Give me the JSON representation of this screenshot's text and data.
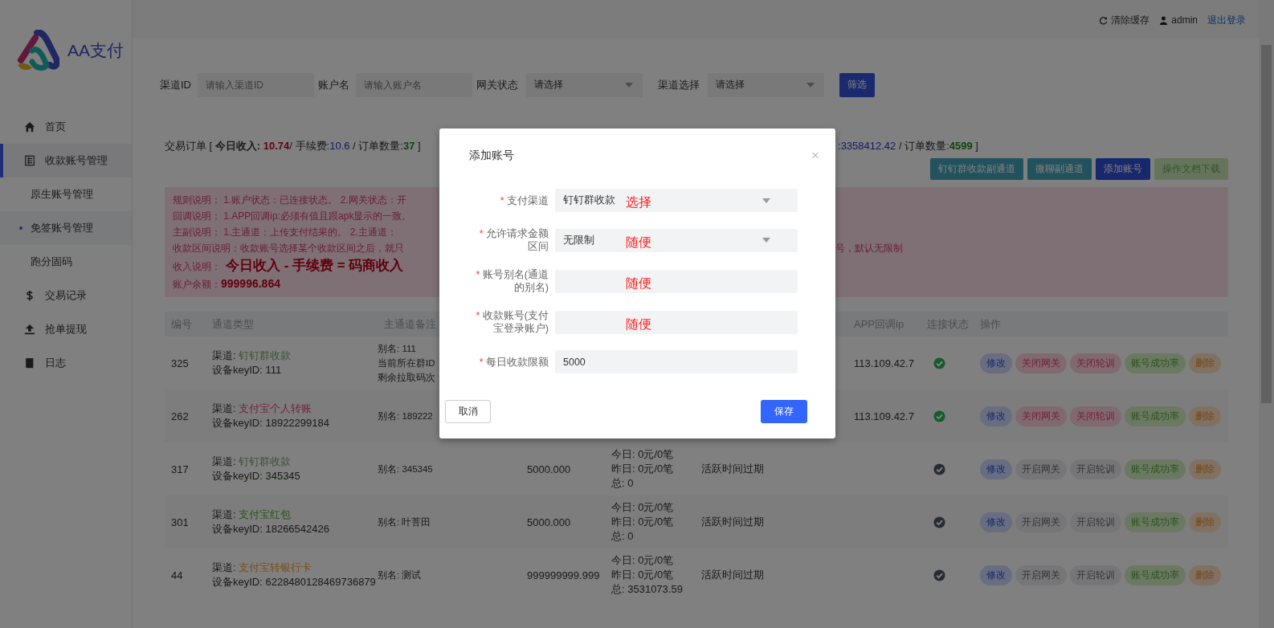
{
  "header": {
    "clear_cache": "清除缓存",
    "user": "admin",
    "logout": "退出登录"
  },
  "logo": {
    "text": "AA支付"
  },
  "sidebar": {
    "items": [
      {
        "label": "首页",
        "kind": "home",
        "selected": false
      },
      {
        "label": "收款账号管理",
        "kind": "list",
        "selected": true,
        "children": [
          {
            "label": "原生账号管理",
            "selected": false
          },
          {
            "label": "免签账号管理",
            "selected": true
          },
          {
            "label": "跑分固码",
            "selected": false
          }
        ]
      },
      {
        "label": "交易记录",
        "kind": "dollar",
        "selected": false
      },
      {
        "label": "抢单提现",
        "kind": "upload",
        "selected": false
      },
      {
        "label": "日志",
        "kind": "book",
        "selected": false
      }
    ]
  },
  "filters": [
    {
      "label": "渠道ID",
      "kind": "input",
      "placeholder": "请输入渠道ID"
    },
    {
      "label": "账户名",
      "kind": "input",
      "placeholder": "请输入账户名"
    },
    {
      "label": "网关状态",
      "kind": "select",
      "placeholder": "请选择"
    },
    {
      "label": "渠道选择",
      "kind": "select",
      "placeholder": "请选择"
    }
  ],
  "filter_button": "筛选",
  "stats": {
    "left": [
      {
        "text": "交易订单 [ ",
        "kind": "plain"
      },
      {
        "text": "今日收入: ",
        "kind": "bold"
      },
      {
        "text": "10.74",
        "kind": "red"
      },
      {
        "text": "/ 手续费:",
        "kind": "plain"
      },
      {
        "text": "10.6",
        "kind": "blue"
      },
      {
        "text": " / 订单数量:",
        "kind": "plain"
      },
      {
        "text": "37",
        "kind": "green"
      },
      {
        "text": " ]",
        "kind": "plain"
      }
    ],
    "right": [
      {
        "text": ":",
        "kind": "plain"
      },
      {
        "text": "3358412.42",
        "kind": "blue"
      },
      {
        "text": " / 订单数量:",
        "kind": "plain"
      },
      {
        "text": "4599",
        "kind": "green"
      },
      {
        "text": " ]",
        "kind": "plain"
      }
    ]
  },
  "toolbar": [
    {
      "label": "钉钉群收款副通道",
      "kind": "teal"
    },
    {
      "label": "微聊副通道",
      "kind": "teal"
    },
    {
      "label": "添加账号",
      "kind": "primary"
    },
    {
      "label": "操作文档下载",
      "kind": "light"
    }
  ],
  "notice": {
    "lines": [
      {
        "label": "规则说明：",
        "text": " 1.账户状态：已连接状态。 2.网关状态：开",
        "kind": "plain"
      },
      {
        "label": "回调说明：",
        "text": " 1.APP回调ip:必须有值且跟apk显示的一致。",
        "kind": "plain"
      },
      {
        "label": "主副说明：",
        "text": " 1.主通道：上传支付结果的。 2.主通道：",
        "kind": "plain"
      },
      {
        "label": "收款区间说明：",
        "text": "收款账号选择某个收款区间之后，就只",
        "kind": "plain",
        "right": "号，默认无限制"
      },
      {
        "label": "收入说明：",
        "text": "今日收入 - 手续费 = 码商收入",
        "kind": "emphasis"
      },
      {
        "label": "账户余额：",
        "text": "999996.864",
        "kind": "strong"
      }
    ]
  },
  "table": {
    "columns": [
      "编号",
      "通道类型",
      "主通道备注",
      "APP回调ip",
      "连接状态",
      "操作"
    ],
    "rows": [
      {
        "id": "325",
        "channel_prefix": "渠道:",
        "channel": "钉钉群收款",
        "kind": "dingtalk",
        "device": "设备keyID: 111",
        "remarks": [
          "别名: 111",
          "当前所在群ID",
          "剩余拉取码次"
        ],
        "ip": "113.109.42.7",
        "connected": true,
        "actions": [
          {
            "label": "修改",
            "kind": "edit"
          },
          {
            "label": "关闭网关",
            "kind": "danger"
          },
          {
            "label": "关闭轮训",
            "kind": "danger"
          },
          {
            "label": "账号成功率",
            "kind": "success"
          },
          {
            "label": "删除",
            "kind": "warn"
          }
        ]
      },
      {
        "id": "262",
        "channel_prefix": "渠道:",
        "channel": "支付宝个人转账",
        "kind": "transfer",
        "device": "设备keyID: 18922299184",
        "remarks": [
          "别名: 189222"
        ],
        "ip": "113.109.42.7",
        "connected": true,
        "actions": [
          {
            "label": "修改",
            "kind": "edit"
          },
          {
            "label": "关闭网关",
            "kind": "danger"
          },
          {
            "label": "关闭轮训",
            "kind": "danger"
          },
          {
            "label": "账号成功率",
            "kind": "success"
          },
          {
            "label": "删除",
            "kind": "warn"
          }
        ]
      },
      {
        "id": "317",
        "channel_prefix": "渠道:",
        "channel": "钉钉群收款",
        "kind": "dingtalk",
        "device": "设备keyID: 345345",
        "remarks": [
          "别名: 345345"
        ],
        "limit": "5000.000",
        "stats": [
          "今日: 0元/0笔",
          "昨日: 0元/0笔",
          "总: 0"
        ],
        "status": "活跃时间过期",
        "connected": false,
        "actions": [
          {
            "label": "修改",
            "kind": "edit"
          },
          {
            "label": "开启网关",
            "kind": "neutral"
          },
          {
            "label": "开启轮训",
            "kind": "neutral"
          },
          {
            "label": "账号成功率",
            "kind": "success"
          },
          {
            "label": "删除",
            "kind": "warn"
          }
        ]
      },
      {
        "id": "301",
        "channel_prefix": "渠道:",
        "channel": "支付宝红包",
        "kind": "redpacket",
        "device": "设备keyID: 18266542426",
        "remarks": [
          "别名: 叶菩田"
        ],
        "limit": "5000.000",
        "stats": [
          "今日: 0元/0笔",
          "昨日: 0元/0笔",
          "总: 0"
        ],
        "status": "活跃时间过期",
        "connected": false,
        "actions": [
          {
            "label": "修改",
            "kind": "edit"
          },
          {
            "label": "开启网关",
            "kind": "neutral"
          },
          {
            "label": "开启轮训",
            "kind": "neutral"
          },
          {
            "label": "账号成功率",
            "kind": "success"
          },
          {
            "label": "删除",
            "kind": "warn"
          }
        ]
      },
      {
        "id": "44",
        "channel_prefix": "渠道:",
        "channel": "支付宝转银行卡",
        "kind": "bank",
        "device": "设备keyID: 6228480128469736879",
        "remarks": [
          "别名: 测试"
        ],
        "limit": "999999999.999",
        "stats": [
          "今日: 0元/0笔",
          "昨日: 0元/0笔",
          "总: 3531073.59"
        ],
        "status": "活跃时间过期",
        "connected": false,
        "actions": [
          {
            "label": "修改",
            "kind": "edit"
          },
          {
            "label": "开启网关",
            "kind": "neutral"
          },
          {
            "label": "开启轮训",
            "kind": "neutral"
          },
          {
            "label": "账号成功率",
            "kind": "success"
          },
          {
            "label": "删除",
            "kind": "warn"
          }
        ]
      }
    ]
  },
  "modal": {
    "title": "添加账号",
    "close": "×",
    "fields": [
      {
        "label": "支付渠道",
        "required_mark": "*",
        "kind": "select",
        "value": "钉钉群收款",
        "annotation": "选择"
      },
      {
        "label": "允许请求金额区间",
        "required_mark": "*",
        "kind": "select",
        "value": "无限制",
        "annotation": "随便"
      },
      {
        "label": "账号别名(通道的别名)",
        "required_mark": "*",
        "kind": "input",
        "annotation": "随便"
      },
      {
        "label": "收款账号(支付宝登录账户)",
        "required_mark": "*",
        "kind": "input",
        "annotation": "随便"
      },
      {
        "label": "每日收款限额",
        "required_mark": "*",
        "kind": "input",
        "value": "5000"
      }
    ],
    "cancel": "取消",
    "save": "保存"
  }
}
